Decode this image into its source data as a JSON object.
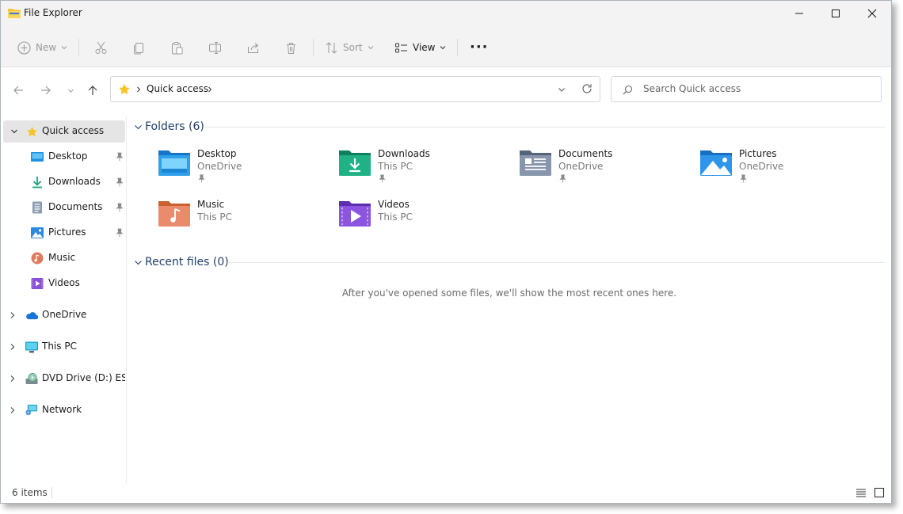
{
  "window": {
    "title": "File Explorer"
  },
  "toolbar": {
    "new_label": "New",
    "sort_label": "Sort",
    "view_label": "View",
    "more_label": "···"
  },
  "address": {
    "location": "Quick access",
    "search_placeholder": "Search Quick access"
  },
  "sidebar": {
    "quick_access": "Quick access",
    "pinned": [
      {
        "label": "Desktop",
        "icon": "desktop-icon"
      },
      {
        "label": "Downloads",
        "icon": "downloads-icon"
      },
      {
        "label": "Documents",
        "icon": "documents-icon"
      },
      {
        "label": "Pictures",
        "icon": "pictures-icon"
      },
      {
        "label": "Music",
        "icon": "music-icon"
      },
      {
        "label": "Videos",
        "icon": "videos-icon"
      }
    ],
    "roots": [
      {
        "label": "OneDrive",
        "icon": "onedrive-icon"
      },
      {
        "label": "This PC",
        "icon": "this-pc-icon"
      },
      {
        "label": "DVD Drive (D:) ESD-ISO",
        "icon": "dvd-drive-icon"
      },
      {
        "label": "Network",
        "icon": "network-icon"
      }
    ]
  },
  "content": {
    "folders_heading": "Folders (6)",
    "folders": [
      {
        "name": "Desktop",
        "location": "OneDrive",
        "pinned": true,
        "color": "#1e90e0"
      },
      {
        "name": "Downloads",
        "location": "This PC",
        "pinned": true,
        "color": "#1aa37a"
      },
      {
        "name": "Documents",
        "location": "OneDrive",
        "pinned": true,
        "color": "#6f7f95"
      },
      {
        "name": "Pictures",
        "location": "OneDrive",
        "pinned": true,
        "color": "#2a8ae0"
      },
      {
        "name": "Music",
        "location": "This PC",
        "pinned": false,
        "color": "#e0826a"
      },
      {
        "name": "Videos",
        "location": "This PC",
        "pinned": false,
        "color": "#8a4fd8"
      }
    ],
    "recent_heading": "Recent files (0)",
    "recent_empty": "After you've opened some files, we'll show the most recent ones here."
  },
  "status": {
    "count": "6 items"
  }
}
